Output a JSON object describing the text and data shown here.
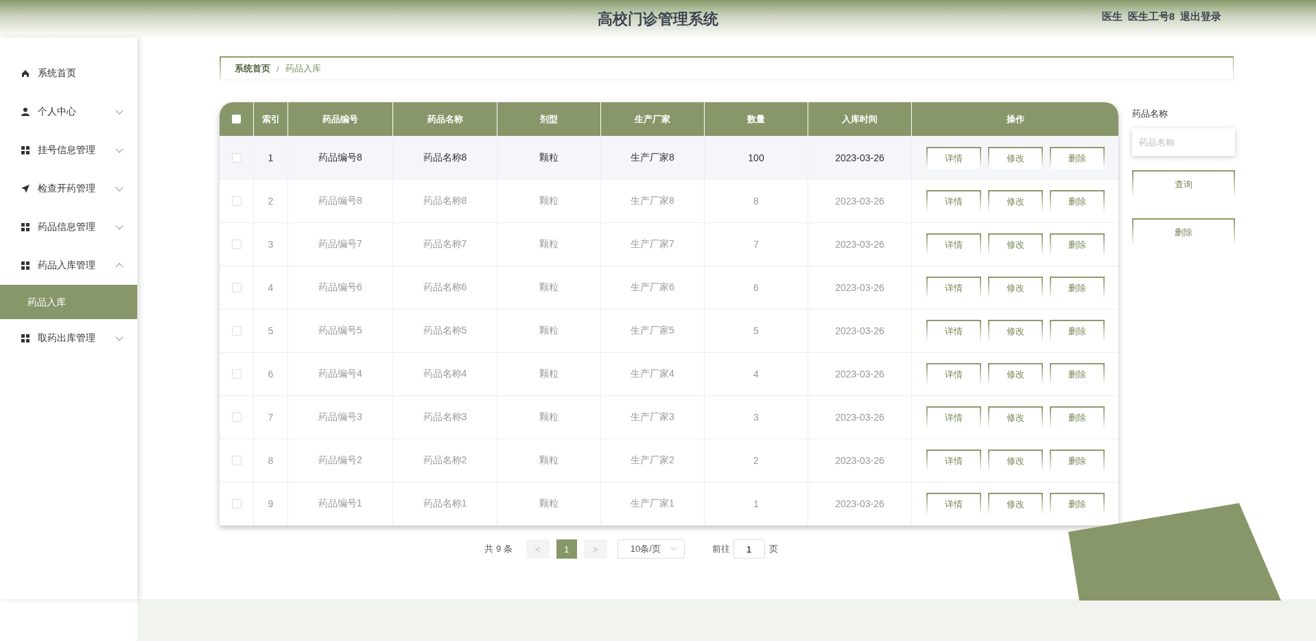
{
  "header": {
    "title": "高校门诊管理系统",
    "user_role": "医生",
    "user_name": "医生工号8",
    "logout": "退出登录"
  },
  "sidebar": {
    "items": [
      {
        "label": "系统首页"
      },
      {
        "label": "个人中心",
        "expanded": false
      },
      {
        "label": "挂号信息管理",
        "expanded": false
      },
      {
        "label": "检查开药管理",
        "expanded": false
      },
      {
        "label": "药品信息管理",
        "expanded": false
      },
      {
        "label": "药品入库管理",
        "expanded": true,
        "children": [
          {
            "label": "药品入库",
            "selected": true
          }
        ]
      },
      {
        "label": "取药出库管理",
        "expanded": false
      }
    ]
  },
  "breadcrumb": [
    "系统首页",
    "药品入库"
  ],
  "breadcrumb_separator": "/",
  "table": {
    "all_checked": false,
    "columns": [
      "索引",
      "药品编号",
      "药品名称",
      "剂型",
      "生产厂家",
      "数量",
      "入库时间",
      "操作"
    ],
    "rows": [
      {
        "checked": false,
        "hovered": true,
        "cells": [
          "1",
          "药品编号8",
          "药品名称8",
          "颗粒",
          "生产厂家8",
          "100",
          "2023-03-26"
        ],
        "actions": [
          "详情",
          "修改",
          "删除"
        ]
      },
      {
        "checked": false,
        "hovered": false,
        "cells": [
          "2",
          "药品编号8",
          "药品名称8",
          "颗粒",
          "生产厂家8",
          "8",
          "2023-03-26"
        ],
        "actions": [
          "详情",
          "修改",
          "删除"
        ]
      },
      {
        "checked": false,
        "hovered": false,
        "cells": [
          "3",
          "药品编号7",
          "药品名称7",
          "颗粒",
          "生产厂家7",
          "7",
          "2023-03-26"
        ],
        "actions": [
          "详情",
          "修改",
          "删除"
        ]
      },
      {
        "checked": false,
        "hovered": false,
        "cells": [
          "4",
          "药品编号6",
          "药品名称6",
          "颗粒",
          "生产厂家6",
          "6",
          "2023-03-26"
        ],
        "actions": [
          "详情",
          "修改",
          "删除"
        ]
      },
      {
        "checked": false,
        "hovered": false,
        "cells": [
          "5",
          "药品编号5",
          "药品名称5",
          "颗粒",
          "生产厂家5",
          "5",
          "2023-03-26"
        ],
        "actions": [
          "详情",
          "修改",
          "删除"
        ]
      },
      {
        "checked": false,
        "hovered": false,
        "cells": [
          "6",
          "药品编号4",
          "药品名称4",
          "颗粒",
          "生产厂家4",
          "4",
          "2023-03-26"
        ],
        "actions": [
          "详情",
          "修改",
          "删除"
        ]
      },
      {
        "checked": false,
        "hovered": false,
        "cells": [
          "7",
          "药品编号3",
          "药品名称3",
          "颗粒",
          "生产厂家3",
          "3",
          "2023-03-26"
        ],
        "actions": [
          "详情",
          "修改",
          "删除"
        ]
      },
      {
        "checked": false,
        "hovered": false,
        "cells": [
          "8",
          "药品编号2",
          "药品名称2",
          "颗粒",
          "生产厂家2",
          "2",
          "2023-03-26"
        ],
        "actions": [
          "详情",
          "修改",
          "删除"
        ]
      },
      {
        "checked": false,
        "hovered": false,
        "cells": [
          "9",
          "药品编号1",
          "药品名称1",
          "颗粒",
          "生产厂家1",
          "1",
          "2023-03-26"
        ],
        "actions": [
          "详情",
          "修改",
          "删除"
        ]
      }
    ]
  },
  "search_panel": {
    "label": "药品名称",
    "placeholder": "药品名称",
    "buttons": [
      "查询",
      "删除"
    ]
  },
  "pagination": {
    "total": "共 9 条",
    "prev": "<",
    "pages": [
      {
        "label": "1",
        "selected": true
      }
    ],
    "next": ">",
    "page_size": "10条/页",
    "goto_label": "前往",
    "goto_value": "1",
    "goto_suffix": "页"
  }
}
